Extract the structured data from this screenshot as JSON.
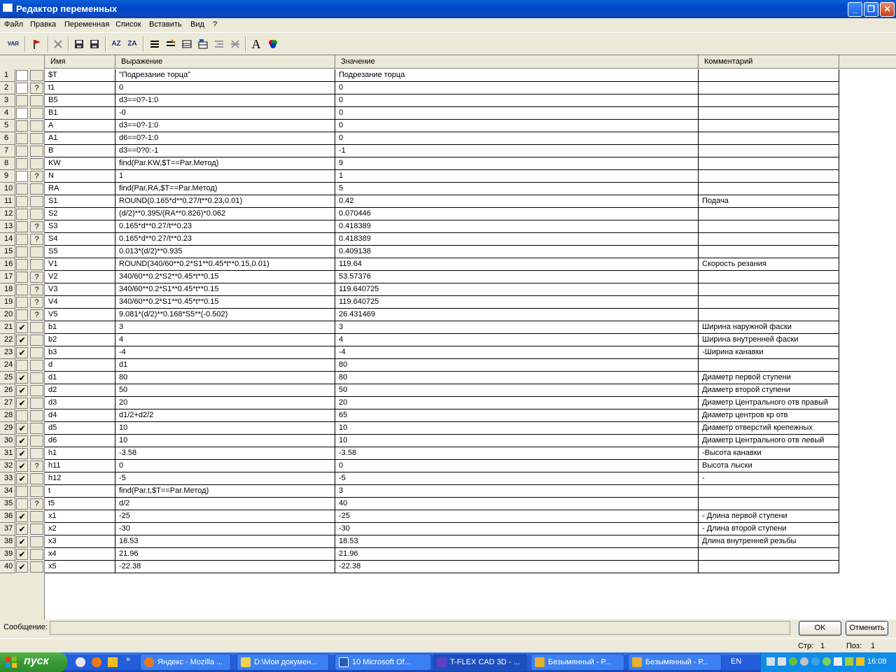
{
  "window": {
    "title": "Редактор переменных"
  },
  "menu": [
    "Файл",
    "Правка",
    "Переменная",
    "Список",
    "Вставить",
    "Вид",
    "?"
  ],
  "toolbar": {
    "var_label": "VAR",
    "sort_az": "AZ",
    "sort_za": "ZA",
    "font_label": "A"
  },
  "columns": [
    "Имя",
    "Выражение",
    "Значение",
    "Комментарий"
  ],
  "rows": [
    {
      "n": "1",
      "check": "",
      "q": "",
      "name": "$T",
      "expr": "\"Подрезание торца\"",
      "value": "Подрезание торца",
      "comment": ""
    },
    {
      "n": "2",
      "check": "",
      "q": "?",
      "name": "t1",
      "expr": "0",
      "value": "0",
      "comment": ""
    },
    {
      "n": "3",
      "check": "",
      "q": "",
      "name": "B5",
      "expr": "d3==0?-1:0",
      "value": "0",
      "comment": ""
    },
    {
      "n": "4",
      "check": "",
      "q": "",
      "name": "B1",
      "expr": "-0",
      "value": "0",
      "comment": ""
    },
    {
      "n": "5",
      "check": "",
      "q": "",
      "name": "A",
      "expr": "d3==0?-1:0",
      "value": "0",
      "comment": ""
    },
    {
      "n": "6",
      "check": "",
      "q": "",
      "name": "A1",
      "expr": "d6==0?-1:0",
      "value": "0",
      "comment": ""
    },
    {
      "n": "7",
      "check": "",
      "q": "",
      "name": "B",
      "expr": "d3==0?0:-1",
      "value": "-1",
      "comment": ""
    },
    {
      "n": "8",
      "check": "",
      "q": "",
      "name": "KW",
      "expr": "find(Par.KW,$T==Par.Метод)",
      "value": "9",
      "comment": ""
    },
    {
      "n": "9",
      "check": "",
      "q": "?",
      "name": "N",
      "expr": "1",
      "value": "1",
      "comment": ""
    },
    {
      "n": "10",
      "check": "",
      "q": "",
      "name": "RA",
      "expr": "find(Par.RA,$T==Par.Метод)",
      "value": "5",
      "comment": ""
    },
    {
      "n": "11",
      "check": "",
      "q": "",
      "name": "S1",
      "expr": "ROUND(0.165*d**0.27/t**0.23,0.01)",
      "value": "0.42",
      "comment": "Подача"
    },
    {
      "n": "12",
      "check": "",
      "q": "",
      "name": "S2",
      "expr": "(d/2)**0.395/(RA**0.826)*0.062",
      "value": "0.070446",
      "comment": ""
    },
    {
      "n": "13",
      "check": "",
      "q": "?",
      "name": "S3",
      "expr": "0.165*d**0.27/t**0.23",
      "value": "0.418389",
      "comment": ""
    },
    {
      "n": "14",
      "check": "",
      "q": "?",
      "name": "S4",
      "expr": "0.165*d**0.27/t**0.23",
      "value": "0.418389",
      "comment": ""
    },
    {
      "n": "15",
      "check": "",
      "q": "",
      "name": "S5",
      "expr": "0.013*(d/2)**0.935",
      "value": "0.409138",
      "comment": ""
    },
    {
      "n": "16",
      "check": "",
      "q": "",
      "name": "V1",
      "expr": "ROUND(340/60**0.2*S1**0.45*t**0.15,0.01)",
      "value": "119.64",
      "comment": "Скорость резания"
    },
    {
      "n": "17",
      "check": "",
      "q": "?",
      "name": "V2",
      "expr": "340/60**0.2*S2**0.45*t**0.15",
      "value": "53.57376",
      "comment": ""
    },
    {
      "n": "18",
      "check": "",
      "q": "?",
      "name": "V3",
      "expr": "340/60**0.2*S1**0.45*t**0.15",
      "value": "119.640725",
      "comment": ""
    },
    {
      "n": "19",
      "check": "",
      "q": "?",
      "name": "V4",
      "expr": "340/60**0.2*S1**0.45*t**0.15",
      "value": "119.640725",
      "comment": ""
    },
    {
      "n": "20",
      "check": "",
      "q": "?",
      "name": "V5",
      "expr": "9.081*(d/2)**0.168*S5**(-0.502)",
      "value": "26.431469",
      "comment": ""
    },
    {
      "n": "21",
      "check": "✔",
      "q": "",
      "name": "b1",
      "expr": "3",
      "value": "3",
      "comment": "Ширина наружной фаски"
    },
    {
      "n": "22",
      "check": "✔",
      "q": "",
      "name": "b2",
      "expr": "4",
      "value": "4",
      "comment": "Ширина внутренней фаски"
    },
    {
      "n": "23",
      "check": "✔",
      "q": "",
      "name": "b3",
      "expr": "-4",
      "value": "-4",
      "comment": "-Ширина канавки"
    },
    {
      "n": "24",
      "check": "",
      "q": "",
      "name": "d",
      "expr": "d1",
      "value": "80",
      "comment": ""
    },
    {
      "n": "25",
      "check": "✔",
      "q": "",
      "name": "d1",
      "expr": "80",
      "value": "80",
      "comment": "Диаметр первой ступени"
    },
    {
      "n": "26",
      "check": "✔",
      "q": "",
      "name": "d2",
      "expr": "50",
      "value": "50",
      "comment": "Диаметр второй ступени"
    },
    {
      "n": "27",
      "check": "✔",
      "q": "",
      "name": "d3",
      "expr": "20",
      "value": "20",
      "comment": "Диаметр Центрального отв правый"
    },
    {
      "n": "28",
      "check": "",
      "q": "",
      "name": "d4",
      "expr": "d1/2+d2/2",
      "value": "65",
      "comment": "Диаметр центров кр отв"
    },
    {
      "n": "29",
      "check": "✔",
      "q": "",
      "name": "d5",
      "expr": "10",
      "value": "10",
      "comment": "Диаметр отверстий крепежных"
    },
    {
      "n": "30",
      "check": "✔",
      "q": "",
      "name": "d6",
      "expr": "10",
      "value": "10",
      "comment": "Диаметр Центрального отв левый"
    },
    {
      "n": "31",
      "check": "✔",
      "q": "",
      "name": "h1",
      "expr": "-3.58",
      "value": "-3.58",
      "comment": "-Высота канавки"
    },
    {
      "n": "32",
      "check": "✔",
      "q": "?",
      "name": "h11",
      "expr": "0",
      "value": "0",
      "comment": "Высота лыски"
    },
    {
      "n": "33",
      "check": "✔",
      "q": "",
      "name": "h12",
      "expr": "-5",
      "value": "-5",
      "comment": "-"
    },
    {
      "n": "34",
      "check": "",
      "q": "",
      "name": "t",
      "expr": "find(Par.t,$T==Par.Метод)",
      "value": "3",
      "comment": ""
    },
    {
      "n": "35",
      "check": "",
      "q": "?",
      "name": "t5",
      "expr": "d/2",
      "value": "40",
      "comment": ""
    },
    {
      "n": "36",
      "check": "✔",
      "q": "",
      "name": "x1",
      "expr": "-25",
      "value": "-25",
      "comment": "- Длина первой ступени"
    },
    {
      "n": "37",
      "check": "✔",
      "q": "",
      "name": "x2",
      "expr": "-30",
      "value": "-30",
      "comment": "- Длина второй ступени"
    },
    {
      "n": "38",
      "check": "✔",
      "q": "",
      "name": "x3",
      "expr": "18.53",
      "value": "18.53",
      "comment": "Длина внутренней резьбы"
    },
    {
      "n": "39",
      "check": "✔",
      "q": "",
      "name": "x4",
      "expr": "21.96",
      "value": "21.96",
      "comment": ""
    },
    {
      "n": "40",
      "check": "✔",
      "q": "",
      "name": "x5",
      "expr": "-22.38",
      "value": "-22.38",
      "comment": ""
    }
  ],
  "footer": {
    "message_label": "Сообщение:",
    "ok_label": "OK",
    "cancel_label": "Отменить",
    "page_label": "Стр:",
    "page_value": "1",
    "pos_label": "Поз:",
    "pos_value": "1"
  },
  "taskbar": {
    "start_label": "пуск",
    "tasks": [
      {
        "label": "Яндекс - Mozilla ...",
        "color": "#e87a20"
      },
      {
        "label": "D:\\Мои докумен...",
        "color": "#f0d050"
      },
      {
        "label": "10 Microsoft Of...",
        "color": "#2a5ab8"
      },
      {
        "label": "T-FLEX CAD 3D - ...",
        "color": "#6040c0"
      },
      {
        "label": "Безымянный - Р...",
        "color": "#e8b030"
      },
      {
        "label": "Безымянный - Р...",
        "color": "#e8b030"
      }
    ],
    "lang": "EN",
    "clock": "16:08"
  }
}
